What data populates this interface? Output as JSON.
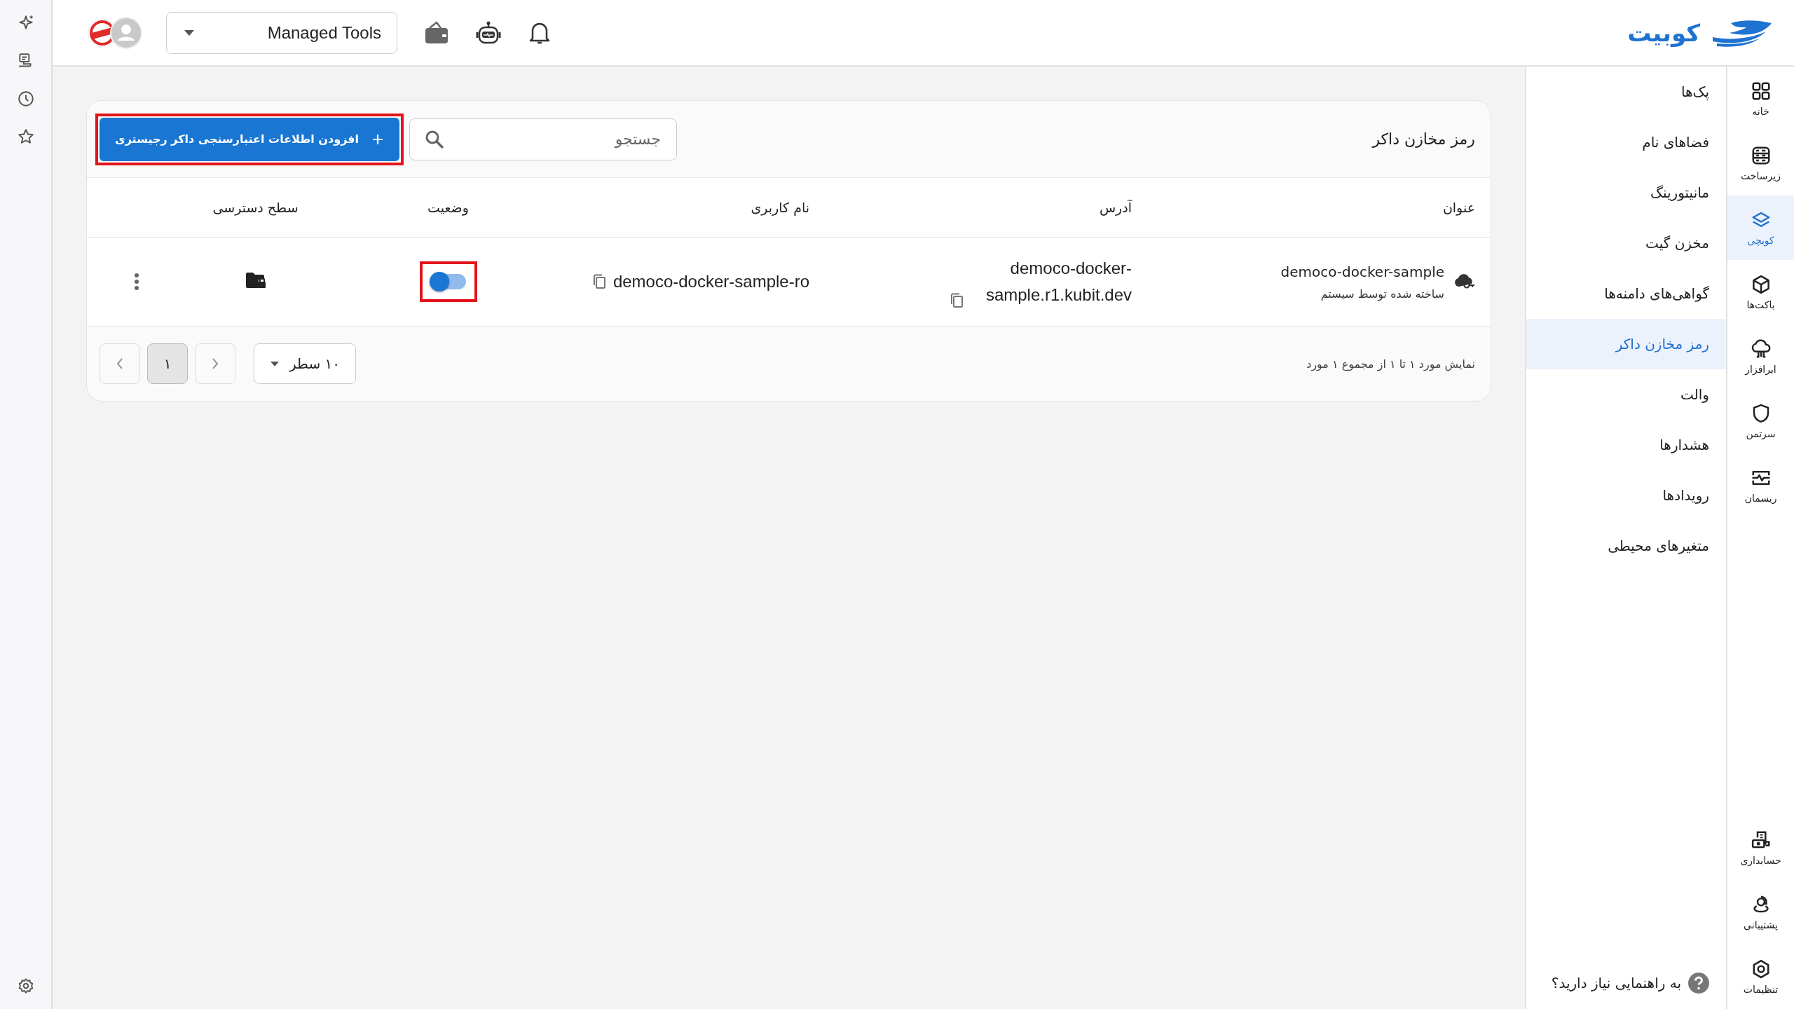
{
  "top_bar": {
    "project_selector": {
      "value": "Managed Tools"
    },
    "logo": {
      "text": "کوبیت"
    }
  },
  "main_nav": [
    {
      "label": "خانه",
      "selected": false
    },
    {
      "label": "زیرساخت",
      "selected": false
    },
    {
      "label": "کوبچی",
      "selected": true
    },
    {
      "label": "باکت‌ها",
      "selected": false
    },
    {
      "label": "ابرافزار",
      "selected": false
    },
    {
      "label": "سرتمن",
      "selected": false
    },
    {
      "label": "ریسمان",
      "selected": false
    }
  ],
  "bottom_nav": [
    {
      "label": "حسابداری",
      "selected": false
    },
    {
      "label": "پشتیبانی",
      "selected": false
    },
    {
      "label": "تنظیمات",
      "selected": false
    }
  ],
  "sub_nav": [
    {
      "label": "پک‌ها",
      "selected": false
    },
    {
      "label": "فضاهای نام",
      "selected": false
    },
    {
      "label": "مانیتورینگ",
      "selected": false
    },
    {
      "label": "مخزن گیت",
      "selected": false
    },
    {
      "label": "گواهی‌های دامنه‌ها",
      "selected": false
    },
    {
      "label": "رمز مخازن داکر",
      "selected": true
    },
    {
      "label": "والت",
      "selected": false
    },
    {
      "label": "هشدارها",
      "selected": false
    },
    {
      "label": "رویدادها",
      "selected": false
    },
    {
      "label": "متغیرهای محیطی",
      "selected": false
    }
  ],
  "help_link": "به راهنمایی نیاز دارید؟",
  "card": {
    "title": "رمز مخازن داکر",
    "search": {
      "placeholder": "جستجو"
    },
    "add_button": {
      "label": "افزودن اطلاعات اعتبارسنجی داکر رجیستری",
      "highlighted": true
    },
    "table": {
      "columns": [
        "عنوان",
        "آدرس",
        "نام کاربری",
        "وضعیت",
        "سطح دسترسی"
      ],
      "rows": [
        {
          "title": "democo-docker-sample",
          "subtitle": "ساخته شده توسط سیستم",
          "address": "democo-docker-sample.r1.kubit.dev",
          "username": "democo-docker-sample-ro",
          "status_on": true,
          "status_highlighted": true
        }
      ]
    },
    "pagination": {
      "summary": "نمایش مورد ۱ تا ۱ از مجموع ۱ مورد",
      "pages": [
        {
          "label": "۱",
          "selected": true
        }
      ],
      "page_size": "۱۰ سطر"
    }
  }
}
